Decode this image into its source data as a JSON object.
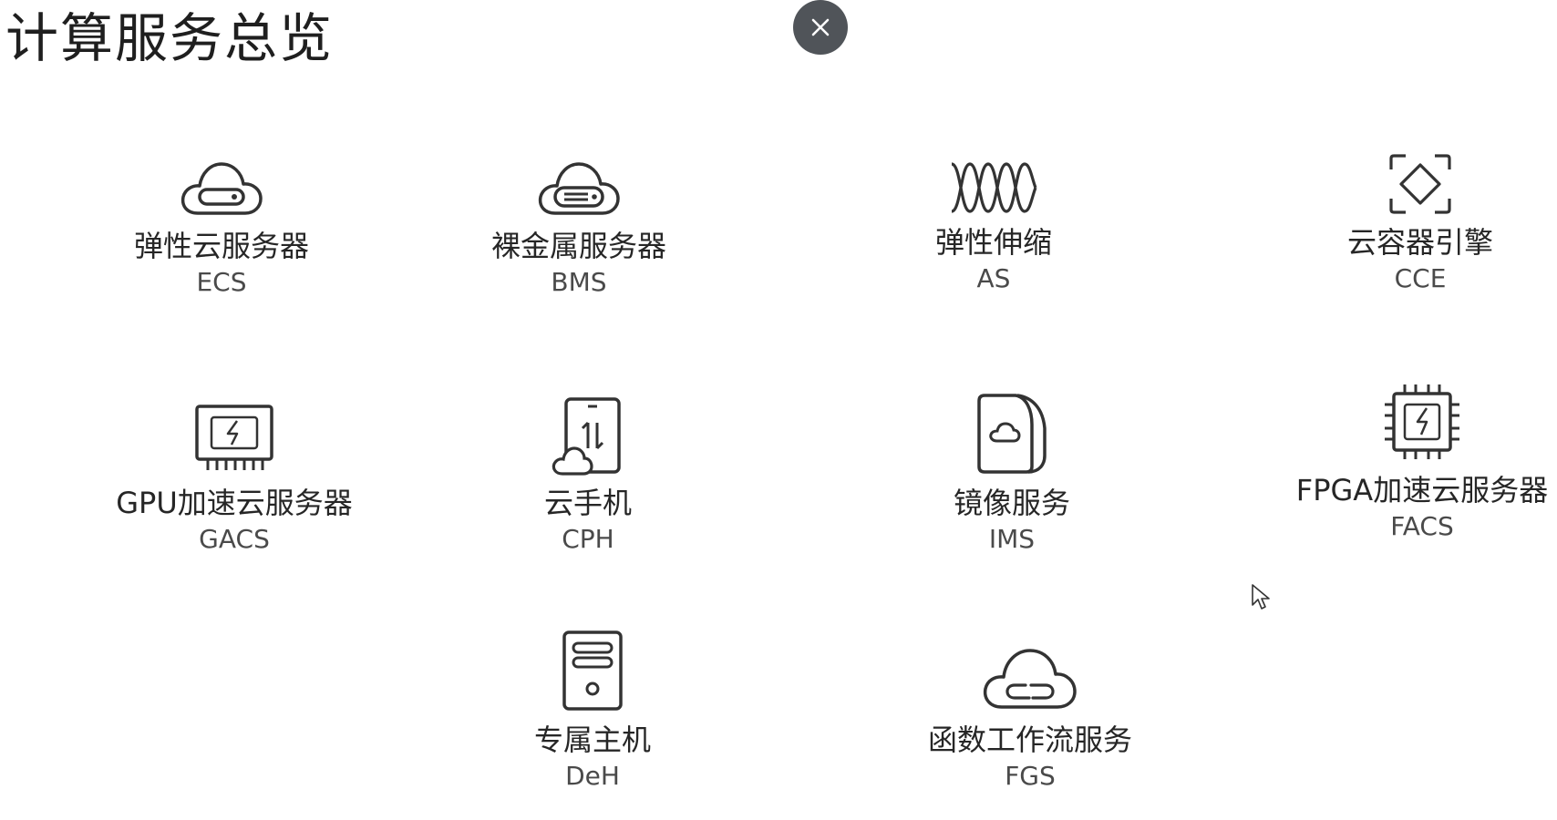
{
  "page": {
    "title": "计算服务总览"
  },
  "close_button": {
    "label": "×"
  },
  "services": [
    {
      "id": "ecs",
      "name": "弹性云服务器",
      "abbr": "ECS",
      "icon": "cloud-server-icon"
    },
    {
      "id": "bms",
      "name": "裸金属服务器",
      "abbr": "BMS",
      "icon": "bare-metal-cloud-icon"
    },
    {
      "id": "as",
      "name": "弹性伸缩",
      "abbr": "AS",
      "icon": "auto-scaling-wave-icon"
    },
    {
      "id": "cce",
      "name": "云容器引擎",
      "abbr": "CCE",
      "icon": "container-engine-icon"
    },
    {
      "id": "gacs",
      "name": "GPU加速云服务器",
      "abbr": "GACS",
      "icon": "gpu-card-icon"
    },
    {
      "id": "cph",
      "name": "云手机",
      "abbr": "CPH",
      "icon": "cloud-phone-icon"
    },
    {
      "id": "ims",
      "name": "镜像服务",
      "abbr": "IMS",
      "icon": "image-service-icon"
    },
    {
      "id": "facs",
      "name": "FPGA加速云服务器",
      "abbr": "FACS",
      "icon": "fpga-chip-icon"
    },
    {
      "id": "deh",
      "name": "专属主机",
      "abbr": "DeH",
      "icon": "dedicated-host-icon"
    },
    {
      "id": "fgs",
      "name": "函数工作流服务",
      "abbr": "FGS",
      "icon": "function-cloud-link-icon"
    }
  ]
}
